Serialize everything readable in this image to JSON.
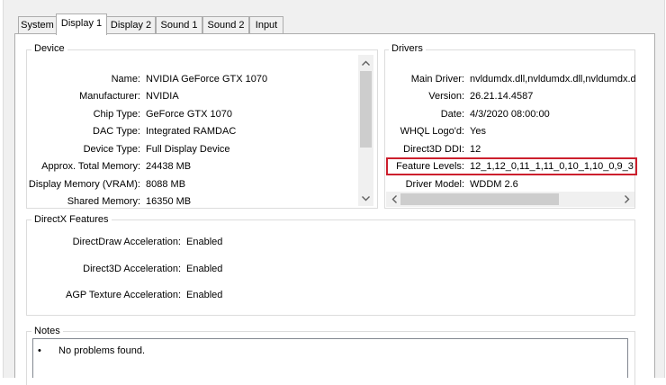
{
  "tabs": [
    {
      "label": "System",
      "active": false
    },
    {
      "label": "Display 1",
      "active": true
    },
    {
      "label": "Display 2",
      "active": false
    },
    {
      "label": "Sound 1",
      "active": false
    },
    {
      "label": "Sound 2",
      "active": false
    },
    {
      "label": "Input",
      "active": false
    }
  ],
  "device": {
    "title": "Device",
    "rows": [
      {
        "label": "Name:",
        "value": "NVIDIA GeForce GTX 1070"
      },
      {
        "label": "Manufacturer:",
        "value": "NVIDIA"
      },
      {
        "label": "Chip Type:",
        "value": "GeForce GTX 1070"
      },
      {
        "label": "DAC Type:",
        "value": "Integrated RAMDAC"
      },
      {
        "label": "Device Type:",
        "value": "Full Display Device"
      },
      {
        "label": "Approx. Total Memory:",
        "value": "24438 MB"
      },
      {
        "label": "Display Memory (VRAM):",
        "value": "8088 MB"
      },
      {
        "label": "Shared Memory:",
        "value": "16350 MB"
      }
    ]
  },
  "drivers": {
    "title": "Drivers",
    "rows": [
      {
        "label": "Main Driver:",
        "value": "nvldumdx.dll,nvldumdx.dll,nvldumdx.d"
      },
      {
        "label": "Version:",
        "value": "26.21.14.4587"
      },
      {
        "label": "Date:",
        "value": "4/3/2020 08:00:00"
      },
      {
        "label": "WHQL Logo'd:",
        "value": "Yes"
      },
      {
        "label": "Direct3D DDI:",
        "value": "12"
      },
      {
        "label": "Feature Levels:",
        "value": "12_1,12_0,11_1,11_0,10_1,10_0,9_3"
      },
      {
        "label": "Driver Model:",
        "value": "WDDM 2.6"
      }
    ]
  },
  "directx": {
    "title": "DirectX Features",
    "rows": [
      {
        "label": "DirectDraw Acceleration:",
        "value": "Enabled"
      },
      {
        "label": "Direct3D Acceleration:",
        "value": "Enabled"
      },
      {
        "label": "AGP Texture Acceleration:",
        "value": "Enabled"
      }
    ]
  },
  "notes": {
    "title": "Notes",
    "bullet": "•",
    "text": "No problems found."
  },
  "icons": {
    "scroll_up": "chevron-up-icon",
    "scroll_down": "chevron-down-icon",
    "scroll_left": "chevron-left-icon",
    "scroll_right": "chevron-right-icon"
  },
  "colors": {
    "highlight": "#cc1f2d",
    "panel": "#ffffff",
    "chrome": "#f0f0f0"
  }
}
